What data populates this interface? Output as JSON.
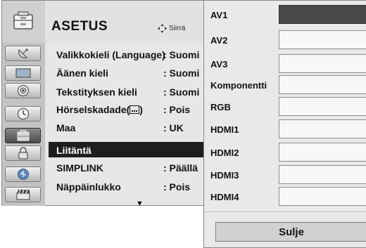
{
  "menu": {
    "title": "ASETUS",
    "header_icon": "settings-cabinet-icon",
    "move_hint": {
      "icon": "four-way-arrows-icon",
      "label": "Siirrä"
    },
    "categories": [
      {
        "icon": "satellite-dish-icon",
        "active": false
      },
      {
        "icon": "tv-picture-icon",
        "active": false
      },
      {
        "icon": "speaker-audio-icon",
        "active": false
      },
      {
        "icon": "clock-time-icon",
        "active": false
      },
      {
        "icon": "settings-option-icon",
        "active": true
      },
      {
        "icon": "lock-icon",
        "active": false
      },
      {
        "icon": "usb-media-icon",
        "active": false
      },
      {
        "icon": "clapperboard-icon",
        "active": false
      }
    ],
    "items": [
      {
        "label": "Valikkokieli (Language)",
        "value": ": Suomi"
      },
      {
        "label": "Äänen kieli",
        "value": ": Suomi"
      },
      {
        "label": "Tekstityksen kieli",
        "value": ": Suomi"
      },
      {
        "label": "Hörselskadade(",
        "value": ": Pois"
      },
      {
        "label": "Maa",
        "value": ": UK"
      },
      {
        "label": "Liitäntä",
        "value": "",
        "selected": true
      },
      {
        "label": "SIMPLINK",
        "value": ": Päällä"
      },
      {
        "label": "Näppäinlukko",
        "value": ": Pois"
      }
    ],
    "scroll_indicator": "▼"
  },
  "input_label_panel": {
    "inputs": [
      {
        "name": "AV1",
        "label_value": "",
        "active": true
      },
      {
        "name": "AV2",
        "label_value": ""
      },
      {
        "name": "AV3",
        "label_value": ""
      },
      {
        "name": "Komponentti",
        "label_value": ""
      },
      {
        "name": "RGB",
        "label_value": ""
      },
      {
        "name": "HDMI1",
        "label_value": ""
      },
      {
        "name": "HDMI2",
        "label_value": ""
      },
      {
        "name": "HDMI3",
        "label_value": ""
      },
      {
        "name": "HDMI4",
        "label_value": ""
      }
    ],
    "close_label": "Sulje"
  },
  "colors": {
    "selected_row": "#1e1e1e",
    "active_field": "#4a4a4a",
    "panel_bg": "#e9e9e9",
    "menu_bg": "#e7e7e7"
  }
}
